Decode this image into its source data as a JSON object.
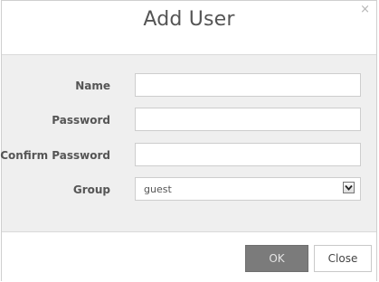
{
  "dialog": {
    "title": "Add User",
    "close_glyph": "×",
    "close_icon": "close-icon"
  },
  "form": {
    "name": {
      "label": "Name",
      "value": "",
      "placeholder": ""
    },
    "password": {
      "label": "Password",
      "value": "",
      "placeholder": ""
    },
    "confirm_password": {
      "label": "Confirm Password",
      "value": "",
      "placeholder": ""
    },
    "group": {
      "label": "Group",
      "selected": "guest",
      "arrow_icon": "chevron-down-icon"
    }
  },
  "buttons": {
    "ok": "OK",
    "close": "Close"
  },
  "colors": {
    "body_background": "#efefef",
    "ok_button": "#7b7b7b",
    "title_text": "#555555"
  }
}
